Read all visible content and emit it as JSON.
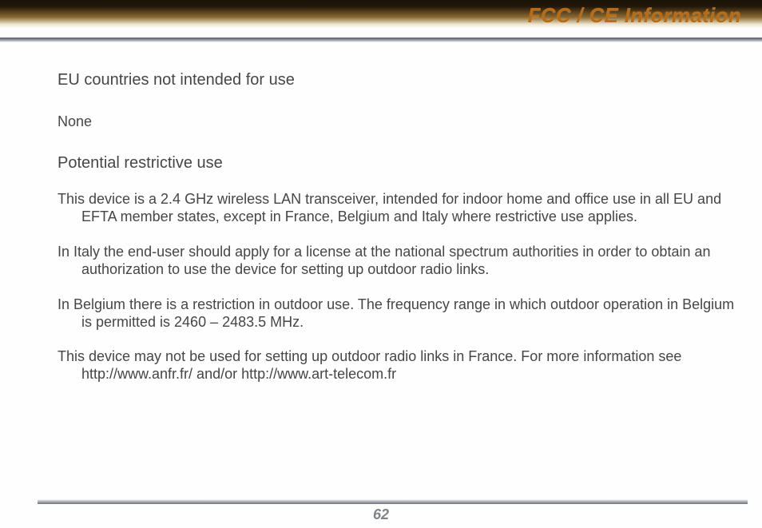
{
  "banner": {
    "title": "FCC / CE Information"
  },
  "body": {
    "heading1": "EU countries not intended for use",
    "none_line": "None",
    "heading2": "Potential restrictive use",
    "para1": "This device is a 2.4 GHz wireless LAN transceiver, intended for indoor home and office use in all EU and EFTA member states, except in France, Belgium and Italy where restrictive use applies.",
    "para2": "In Italy the end-user should apply for a license at the national spectrum authorities in order to obtain an authorization to use the device for setting up outdoor radio links.",
    "para3": "In Belgium there is a restriction in outdoor use. The frequency range in which outdoor operation in Belgium is permitted is 2460 – 2483.5 MHz.",
    "para4": "This device may not be used for setting up outdoor radio links in France. For more information see http://www.anfr.fr/ and/or http://www.art-telecom.fr"
  },
  "footer": {
    "page_number": "62"
  }
}
